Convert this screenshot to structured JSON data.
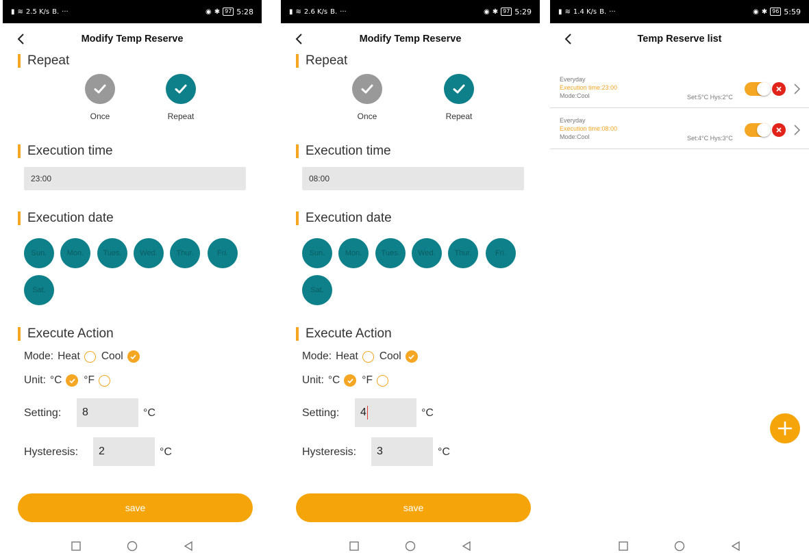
{
  "colors": {
    "accent": "#f5a623",
    "teal": "#0e8089",
    "grey": "#999999",
    "field_bg": "#e6e6e6",
    "delete_red": "#e2231a"
  },
  "screens": [
    {
      "status": {
        "speed": "2.5 K/s",
        "time": "5:28",
        "battery": "97"
      },
      "title": "Modify Temp Reserve",
      "repeat": {
        "heading": "Repeat",
        "options": [
          {
            "label": "Once",
            "selected": false
          },
          {
            "label": "Repeat",
            "selected": true
          }
        ]
      },
      "execution_time": {
        "heading": "Execution time",
        "value": "23:00"
      },
      "execution_date": {
        "heading": "Execution date",
        "days": [
          "Sun.",
          "Mon.",
          "Tues.",
          "Wed.",
          "Thur.",
          "Fri.",
          "Sat."
        ]
      },
      "action": {
        "heading": "Execute Action",
        "mode_label": "Mode:",
        "mode_heat": "Heat",
        "mode_cool": "Cool",
        "mode_selected": "Cool",
        "unit_label": "Unit:",
        "unit_c": "°C",
        "unit_f": "°F",
        "unit_selected": "°C",
        "setting_label": "Setting:",
        "setting_value": "8",
        "setting_unit": "°C",
        "hysteresis_label": "Hysteresis:",
        "hysteresis_value": "2",
        "hysteresis_unit": "°C"
      },
      "save_label": "save"
    },
    {
      "status": {
        "speed": "2.6 K/s",
        "time": "5:29",
        "battery": "97"
      },
      "title": "Modify Temp Reserve",
      "repeat": {
        "heading": "Repeat",
        "options": [
          {
            "label": "Once",
            "selected": false
          },
          {
            "label": "Repeat",
            "selected": true
          }
        ]
      },
      "execution_time": {
        "heading": "Execution time",
        "value": "08:00"
      },
      "execution_date": {
        "heading": "Execution date",
        "days": [
          "Sun.",
          "Mon.",
          "Tues.",
          "Wed.",
          "Thur.",
          "Fri.",
          "Sat."
        ]
      },
      "action": {
        "heading": "Execute Action",
        "mode_label": "Mode:",
        "mode_heat": "Heat",
        "mode_cool": "Cool",
        "mode_selected": "Cool",
        "unit_label": "Unit:",
        "unit_c": "°C",
        "unit_f": "°F",
        "unit_selected": "°C",
        "setting_label": "Setting:",
        "setting_value": "4",
        "setting_unit": "°C",
        "hysteresis_label": "Hysteresis:",
        "hysteresis_value": "3",
        "hysteresis_unit": "°C"
      },
      "save_label": "save"
    }
  ],
  "list_screen": {
    "status": {
      "speed": "1.4 K/s",
      "time": "5:59",
      "battery": "96"
    },
    "title": "Temp Reserve list",
    "items": [
      {
        "repeat": "Everyday",
        "exec": "Execution time:23:00",
        "mode": "Mode:Cool",
        "set": "Set:5°C  Hys:2°C",
        "enabled": true
      },
      {
        "repeat": "Everyday",
        "exec": "Execution time:08:00",
        "mode": "Mode:Cool",
        "set": "Set:4°C  Hys:3°C",
        "enabled": true
      }
    ]
  }
}
